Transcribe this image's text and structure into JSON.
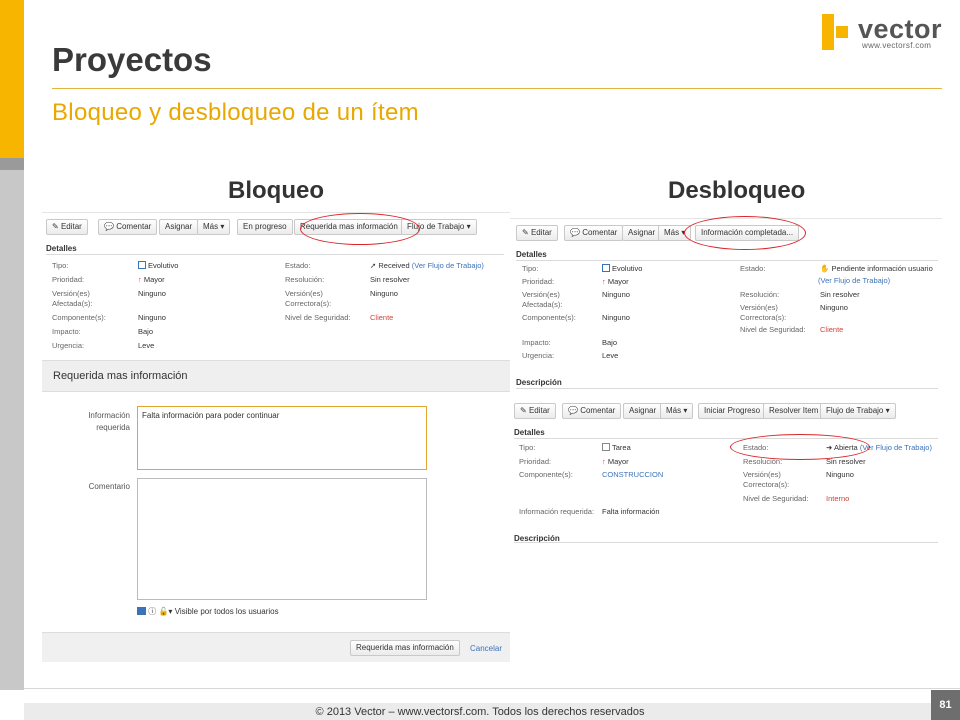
{
  "slide": {
    "title": "Proyectos",
    "subtitle": "Bloqueo y desbloqueo de un ítem",
    "logo_word": "vector",
    "logo_url": "www.vectorsf.com",
    "footer": "© 2013 Vector – www.vectorsf.com. Todos los derechos reservados",
    "page_number": "81",
    "accent_color": "#f7b500"
  },
  "bloqueo": {
    "heading": "Bloqueo",
    "toolbar": {
      "editar": "Editar",
      "comentar": "Comentar",
      "asignar": "Asignar",
      "mas": "Más",
      "en_progreso": "En progreso",
      "requerida": "Requerida mas información",
      "flujo": "Flujo de Trabajo"
    },
    "details_title": "Detalles",
    "left_fields": [
      {
        "label": "Tipo:",
        "value": "Evolutivo"
      },
      {
        "label": "Prioridad:",
        "value": "Mayor"
      },
      {
        "label": "Versión(es)\nAfectada(s):",
        "value": "Ninguno"
      },
      {
        "label": "Componente(s):",
        "value": "Ninguno"
      },
      {
        "label": "Impacto:",
        "value": "Bajo"
      },
      {
        "label": "Urgencia:",
        "value": "Leve"
      }
    ],
    "right_fields": [
      {
        "label": "Estado:",
        "value": "Received",
        "link": "(Ver Flujo de Trabajo)"
      },
      {
        "label": "Resolución:",
        "value": "Sin resolver"
      },
      {
        "label": "Versión(es)\nCorrectora(s):",
        "value": "Ninguno"
      },
      {
        "label": "Nivel de Seguridad:",
        "value": "Cliente"
      }
    ],
    "dialog": {
      "title": "Requerida mas información",
      "info_label": "Información\nrequerida",
      "info_value": "Falta información para poder continuar",
      "comment_label": "Comentario",
      "visibility": "Visible por todos los usuarios",
      "submit": "Requerida mas información",
      "cancel": "Cancelar"
    }
  },
  "desbloqueo": {
    "heading": "Desbloqueo",
    "toolbar1": {
      "editar": "Editar",
      "comentar": "Comentar",
      "asignar": "Asignar",
      "mas": "Más",
      "info_completada": "Información completada..."
    },
    "details_title": "Detalles",
    "left_fields": [
      {
        "label": "Tipo:",
        "value": "Evolutivo"
      },
      {
        "label": "Prioridad:",
        "value": "Mayor"
      },
      {
        "label": "Versión(es)\nAfectada(s):",
        "value": "Ninguno"
      },
      {
        "label": "Componente(s):",
        "value": "Ninguno"
      },
      {
        "label": "Impacto:",
        "value": "Bajo"
      },
      {
        "label": "Urgencia:",
        "value": "Leve"
      }
    ],
    "right_fields": [
      {
        "label": "Estado:",
        "value": "Pendiente información usuario",
        "link": "(Ver Flujo de Trabajo)"
      },
      {
        "label": "Resolución:",
        "value": "Sin resolver"
      },
      {
        "label": "Versión(es)\nCorrectora(s):",
        "value": "Ninguno"
      },
      {
        "label": "Nivel de Seguridad:",
        "value": "Cliente"
      }
    ],
    "description_title": "Descripción",
    "toolbar2": {
      "editar": "Editar",
      "comentar": "Comentar",
      "asignar": "Asignar",
      "mas": "Más",
      "iniciar": "Iniciar Progreso",
      "resolver": "Resolver Item",
      "flujo": "Flujo de Trabajo"
    },
    "details2_title": "Detalles",
    "left_fields2": [
      {
        "label": "Tipo:",
        "value": "Tarea"
      },
      {
        "label": "Prioridad:",
        "value": "Mayor"
      },
      {
        "label": "Componente(s):",
        "value": "CONSTRUCCION"
      },
      {
        "label": "Información requerida:",
        "value": "Falta información"
      }
    ],
    "right_fields2": [
      {
        "label": "Estado:",
        "value": "Abierta",
        "link": "(Ver Flujo de Trabajo)"
      },
      {
        "label": "Resolución:",
        "value": "Sin resolver"
      },
      {
        "label": "Versión(es)\nCorrectora(s):",
        "value": "Ninguno"
      },
      {
        "label": "Nivel de Seguridad:",
        "value": "Interno"
      }
    ],
    "description2_title": "Descripción"
  }
}
